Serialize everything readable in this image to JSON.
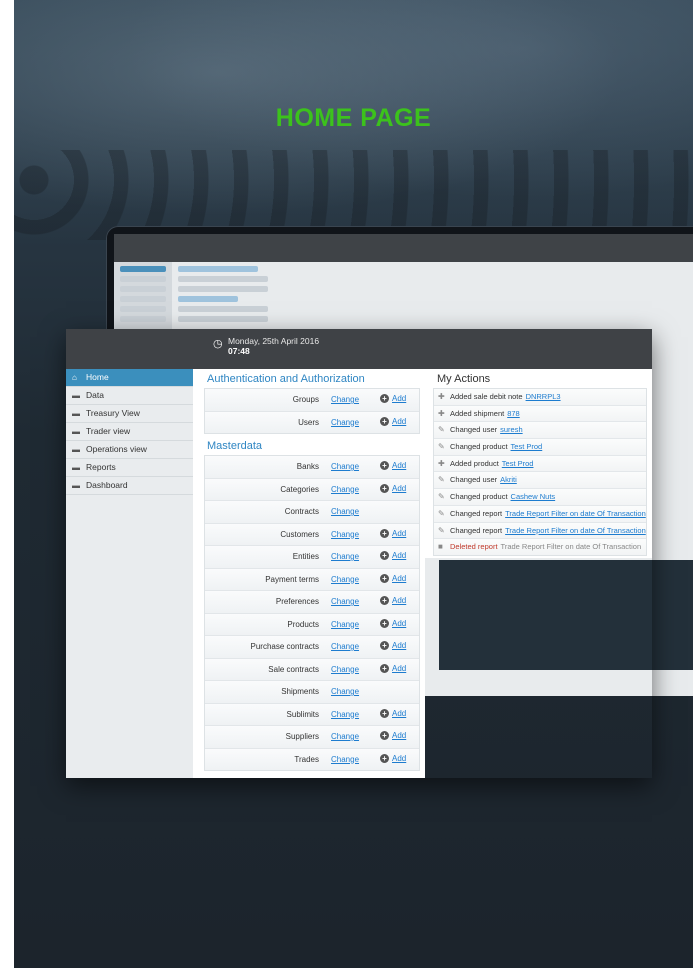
{
  "headline": "HOME PAGE",
  "header": {
    "date": "Monday, 25th April 2016",
    "time": "07:48",
    "clock_icon": "clock-icon"
  },
  "sidebar": {
    "items": [
      {
        "label": "Home",
        "icon": "home-icon",
        "active": true
      },
      {
        "label": "Data",
        "icon": "folder-icon"
      },
      {
        "label": "Treasury View",
        "icon": "folder-icon"
      },
      {
        "label": "Trader view",
        "icon": "folder-icon"
      },
      {
        "label": "Operations view",
        "icon": "folder-icon"
      },
      {
        "label": "Reports",
        "icon": "folder-icon"
      },
      {
        "label": "Dashboard",
        "icon": "folder-icon"
      }
    ]
  },
  "auth": {
    "title": "Authentication and Authorization",
    "rows": [
      {
        "label": "Groups",
        "change": "Change",
        "add": "Add"
      },
      {
        "label": "Users",
        "change": "Change",
        "add": "Add"
      }
    ]
  },
  "masterdata": {
    "title": "Masterdata",
    "rows": [
      {
        "label": "Banks",
        "change": "Change",
        "add": "Add"
      },
      {
        "label": "Categories",
        "change": "Change",
        "add": "Add"
      },
      {
        "label": "Contracts",
        "change": "Change",
        "add": ""
      },
      {
        "label": "Customers",
        "change": "Change",
        "add": "Add"
      },
      {
        "label": "Entities",
        "change": "Change",
        "add": "Add"
      },
      {
        "label": "Payment terms",
        "change": "Change",
        "add": "Add"
      },
      {
        "label": "Preferences",
        "change": "Change",
        "add": "Add"
      },
      {
        "label": "Products",
        "change": "Change",
        "add": "Add"
      },
      {
        "label": "Purchase contracts",
        "change": "Change",
        "add": "Add"
      },
      {
        "label": "Sale contracts",
        "change": "Change",
        "add": "Add"
      },
      {
        "label": "Shipments",
        "change": "Change",
        "add": ""
      },
      {
        "label": "Sublimits",
        "change": "Change",
        "add": "Add"
      },
      {
        "label": "Suppliers",
        "change": "Change",
        "add": "Add"
      },
      {
        "label": "Trades",
        "change": "Change",
        "add": "Add"
      }
    ]
  },
  "actions": {
    "title": "My Actions",
    "items": [
      {
        "icon": "plus-icon",
        "text": "Added sale debit note",
        "link": "DNRRPL3"
      },
      {
        "icon": "plus-icon",
        "text": "Added shipment",
        "link": "878"
      },
      {
        "icon": "pencil-icon",
        "text": "Changed user",
        "link": "suresh"
      },
      {
        "icon": "pencil-icon",
        "text": "Changed product",
        "link": "Test Prod"
      },
      {
        "icon": "plus-icon",
        "text": "Added product",
        "link": "Test Prod"
      },
      {
        "icon": "pencil-icon",
        "text": "Changed user",
        "link": "Akriti"
      },
      {
        "icon": "pencil-icon",
        "text": "Changed product",
        "link": "Cashew Nuts"
      },
      {
        "icon": "pencil-icon",
        "text": "Changed report",
        "link": "Trade Report Filter on date Of Transaction"
      },
      {
        "icon": "pencil-icon",
        "text": "Changed report",
        "link": "Trade Report Filter on date Of Transaction"
      },
      {
        "icon": "trash-icon",
        "text": "Deleted report",
        "link": "Trade Report Filter on date Of Transaction",
        "deleted": true
      }
    ]
  },
  "colors": {
    "accent": "#3cc21c",
    "link": "#1d7ccf",
    "nav_active": "#3b8fbd",
    "section_title": "#2f86c3"
  }
}
